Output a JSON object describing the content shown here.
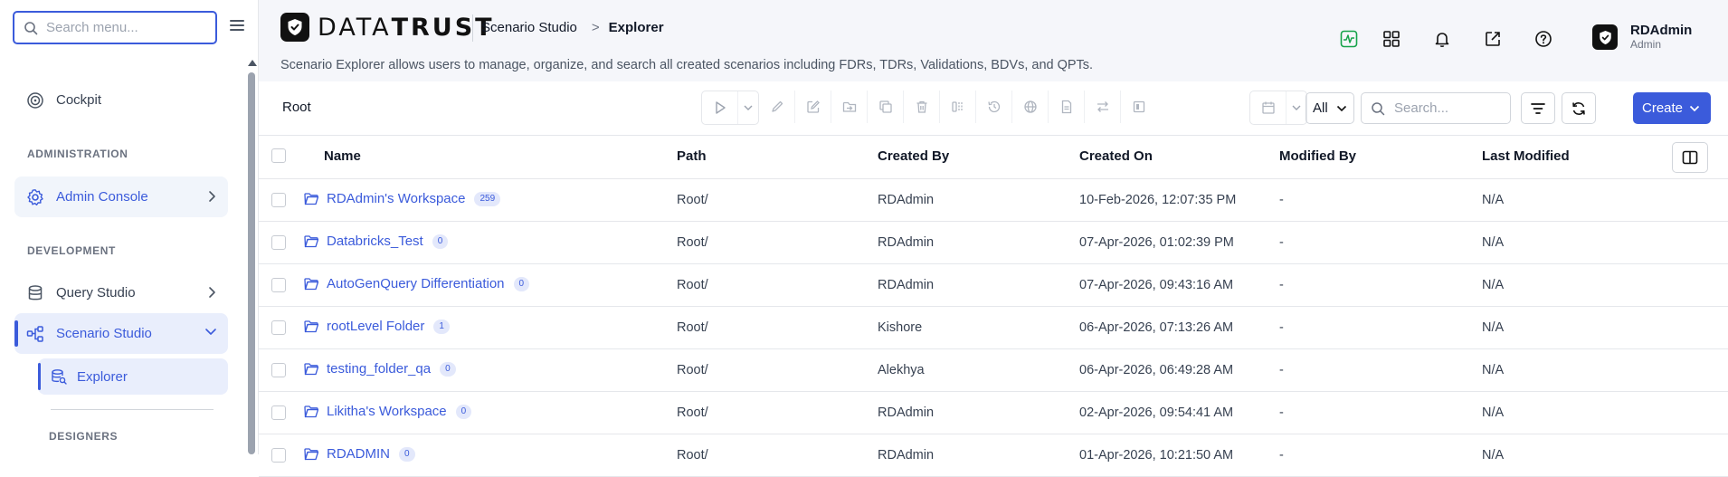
{
  "sidebar": {
    "search_placeholder": "Search menu...",
    "cockpit": "Cockpit",
    "section_administration": "ADMINISTRATION",
    "admin_console": "Admin Console",
    "section_development": "DEVELOPMENT",
    "query_studio": "Query Studio",
    "scenario_studio": "Scenario Studio",
    "explorer": "Explorer",
    "section_designers": "DESIGNERS"
  },
  "header": {
    "brand_light": "DATA",
    "brand_bold": "TRUST",
    "breadcrumb_parent": "Scenario Studio",
    "breadcrumb_separator": ">",
    "breadcrumb_current": "Explorer",
    "description": "Scenario Explorer allows users to manage, organize, and search all created scenarios including FDRs, TDRs, Validations, BDVs, and QPTs.",
    "user_name": "RDAdmin",
    "user_role": "Admin"
  },
  "toolbar": {
    "root_label": "Root",
    "filter_value": "All",
    "search_placeholder": "Search...",
    "create_label": "Create"
  },
  "table": {
    "columns": [
      "Name",
      "Path",
      "Created By",
      "Created On",
      "Modified By",
      "Last Modified"
    ],
    "rows": [
      {
        "name": "RDAdmin's Workspace",
        "count": "259",
        "path": "Root/",
        "created_by": "RDAdmin",
        "created_on": "10-Feb-2026, 12:07:35 PM",
        "modified_by": "-",
        "last_modified": "N/A"
      },
      {
        "name": "Databricks_Test",
        "count": "0",
        "path": "Root/",
        "created_by": "RDAdmin",
        "created_on": "07-Apr-2026, 01:02:39 PM",
        "modified_by": "-",
        "last_modified": "N/A"
      },
      {
        "name": "AutoGenQuery Differentiation",
        "count": "0",
        "path": "Root/",
        "created_by": "RDAdmin",
        "created_on": "07-Apr-2026, 09:43:16 AM",
        "modified_by": "-",
        "last_modified": "N/A"
      },
      {
        "name": "rootLevel Folder",
        "count": "1",
        "path": "Root/",
        "created_by": "Kishore",
        "created_on": "06-Apr-2026, 07:13:26 AM",
        "modified_by": "-",
        "last_modified": "N/A"
      },
      {
        "name": "testing_folder_qa",
        "count": "0",
        "path": "Root/",
        "created_by": "Alekhya",
        "created_on": "06-Apr-2026, 06:49:28 AM",
        "modified_by": "-",
        "last_modified": "N/A"
      },
      {
        "name": "Likitha's Workspace",
        "count": "0",
        "path": "Root/",
        "created_by": "RDAdmin",
        "created_on": "02-Apr-2026, 09:54:41 AM",
        "modified_by": "-",
        "last_modified": "N/A"
      },
      {
        "name": "RDADMIN",
        "count": "0",
        "path": "Root/",
        "created_by": "RDAdmin",
        "created_on": "01-Apr-2026, 10:21:50 AM",
        "modified_by": "-",
        "last_modified": "N/A"
      }
    ]
  },
  "colors": {
    "accent": "#3b5bdb",
    "header_bg": "#f5f6fa",
    "badge_bg": "#e3e8fb",
    "activity_icon": "#16a34a"
  },
  "icons": {
    "toolbar": [
      "play-icon",
      "chevron-down-icon",
      "pencil-icon",
      "edit-icon",
      "move-icon",
      "copy-icon",
      "trash-icon",
      "split-icon",
      "history-icon",
      "globe-icon",
      "document-icon",
      "swap-icon",
      "panel-icon",
      "calendar-icon",
      "chevron-down-icon"
    ],
    "header": [
      "activity-icon",
      "grid-icon",
      "bell-icon",
      "external-link-icon",
      "help-icon"
    ]
  }
}
